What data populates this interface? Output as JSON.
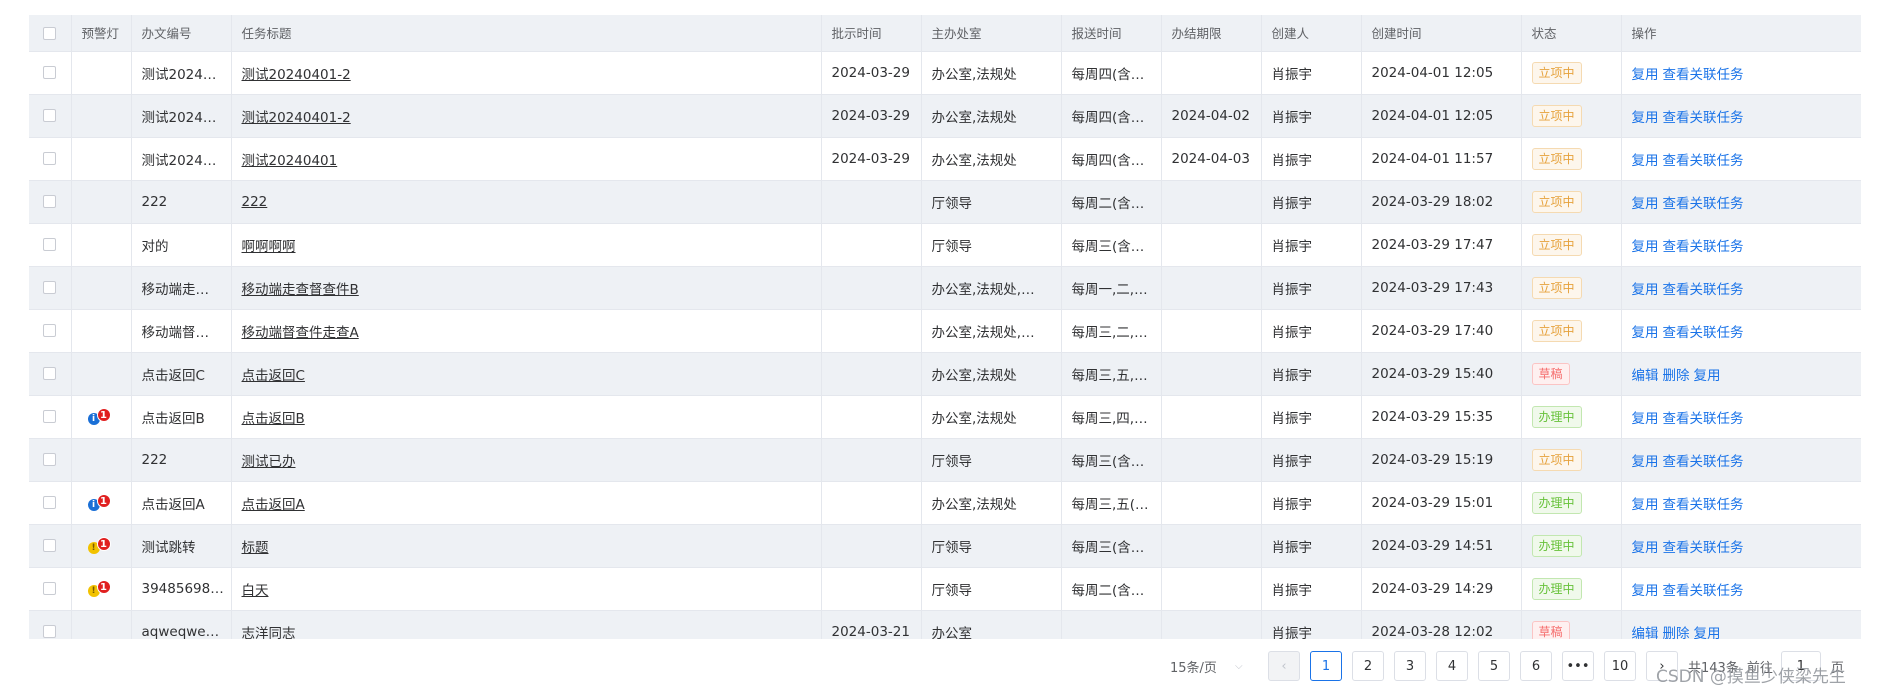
{
  "headers": [
    "",
    "预警灯",
    "办文编号",
    "任务标题",
    "批示时间",
    "主办处室",
    "报送时间",
    "办结期限",
    "创建人",
    "创建时间",
    "状态",
    "操作"
  ],
  "rows": [
    {
      "warning": "",
      "badge": "",
      "doc_no": "测试2024…",
      "title": "测试20240401-2",
      "instr_date": "2024-03-29",
      "dept": "办公室,法规处",
      "report": "每周四(含…",
      "deadline": "",
      "creator": "肖振宇",
      "created": "2024-04-01 12:05",
      "status": "立项中",
      "status_color": "orange",
      "ops": [
        "复用",
        "查看关联任务"
      ]
    },
    {
      "warning": "",
      "badge": "",
      "doc_no": "测试2024…",
      "title": "测试20240401-2",
      "instr_date": "2024-03-29",
      "dept": "办公室,法规处",
      "report": "每周四(含…",
      "deadline": "2024-04-02",
      "creator": "肖振宇",
      "created": "2024-04-01 12:05",
      "status": "立项中",
      "status_color": "orange",
      "ops": [
        "复用",
        "查看关联任务"
      ]
    },
    {
      "warning": "",
      "badge": "",
      "doc_no": "测试2024…",
      "title": "测试20240401",
      "instr_date": "2024-03-29",
      "dept": "办公室,法规处",
      "report": "每周四(含…",
      "deadline": "2024-04-03",
      "creator": "肖振宇",
      "created": "2024-04-01 11:57",
      "status": "立项中",
      "status_color": "orange",
      "ops": [
        "复用",
        "查看关联任务"
      ]
    },
    {
      "warning": "",
      "badge": "",
      "doc_no": "222",
      "title": "222",
      "instr_date": "",
      "dept": "厅领导",
      "report": "每周二(含…",
      "deadline": "",
      "creator": "肖振宇",
      "created": "2024-03-29 18:02",
      "status": "立项中",
      "status_color": "orange",
      "ops": [
        "复用",
        "查看关联任务"
      ]
    },
    {
      "warning": "",
      "badge": "",
      "doc_no": "对的",
      "title": "啊啊啊啊",
      "instr_date": "",
      "dept": "厅领导",
      "report": "每周三(含…",
      "deadline": "",
      "creator": "肖振宇",
      "created": "2024-03-29 17:47",
      "status": "立项中",
      "status_color": "orange",
      "ops": [
        "复用",
        "查看关联任务"
      ]
    },
    {
      "warning": "",
      "badge": "",
      "doc_no": "移动端走…",
      "title": "移动端走查督查件B",
      "instr_date": "",
      "dept": "办公室,法规处,…",
      "report": "每周一,二,…",
      "deadline": "",
      "creator": "肖振宇",
      "created": "2024-03-29 17:43",
      "status": "立项中",
      "status_color": "orange",
      "ops": [
        "复用",
        "查看关联任务"
      ]
    },
    {
      "warning": "",
      "badge": "",
      "doc_no": "移动端督…",
      "title": "移动端督查件走查A",
      "instr_date": "",
      "dept": "办公室,法规处,…",
      "report": "每周三,二,…",
      "deadline": "",
      "creator": "肖振宇",
      "created": "2024-03-29 17:40",
      "status": "立项中",
      "status_color": "orange",
      "ops": [
        "复用",
        "查看关联任务"
      ]
    },
    {
      "warning": "",
      "badge": "",
      "doc_no": "点击返回C",
      "title": "点击返回C",
      "instr_date": "",
      "dept": "办公室,法规处",
      "report": "每周三,五,…",
      "deadline": "",
      "creator": "肖振宇",
      "created": "2024-03-29 15:40",
      "status": "草稿",
      "status_color": "red",
      "ops": [
        "编辑",
        "删除",
        "复用"
      ]
    },
    {
      "warning": "blue",
      "badge": "1",
      "doc_no": "点击返回B",
      "title": "点击返回B",
      "instr_date": "",
      "dept": "办公室,法规处",
      "report": "每周三,四,…",
      "deadline": "",
      "creator": "肖振宇",
      "created": "2024-03-29 15:35",
      "status": "办理中",
      "status_color": "green",
      "ops": [
        "复用",
        "查看关联任务"
      ]
    },
    {
      "warning": "",
      "badge": "",
      "doc_no": "222",
      "title": "测试已办",
      "instr_date": "",
      "dept": "厅领导",
      "report": "每周三(含…",
      "deadline": "",
      "creator": "肖振宇",
      "created": "2024-03-29 15:19",
      "status": "立项中",
      "status_color": "orange",
      "ops": [
        "复用",
        "查看关联任务"
      ]
    },
    {
      "warning": "blue",
      "badge": "1",
      "doc_no": "点击返回A",
      "title": "点击返回A",
      "instr_date": "",
      "dept": "办公室,法规处",
      "report": "每周三,五(…",
      "deadline": "",
      "creator": "肖振宇",
      "created": "2024-03-29 15:01",
      "status": "办理中",
      "status_color": "green",
      "ops": [
        "复用",
        "查看关联任务"
      ]
    },
    {
      "warning": "yellow",
      "badge": "1",
      "doc_no": "测试跳转",
      "title": "标题",
      "instr_date": "",
      "dept": "厅领导",
      "report": "每周三(含…",
      "deadline": "",
      "creator": "肖振宇",
      "created": "2024-03-29 14:51",
      "status": "办理中",
      "status_color": "green",
      "ops": [
        "复用",
        "查看关联任务"
      ]
    },
    {
      "warning": "yellow",
      "badge": "1",
      "doc_no": "39485698…",
      "title": "白天",
      "instr_date": "",
      "dept": "厅领导",
      "report": "每周二(含…",
      "deadline": "",
      "creator": "肖振宇",
      "created": "2024-03-29 14:29",
      "status": "办理中",
      "status_color": "green",
      "ops": [
        "复用",
        "查看关联任务"
      ]
    },
    {
      "warning": "",
      "badge": "",
      "doc_no": "aqweqwe…",
      "title": "志洋同志",
      "instr_date": "2024-03-21",
      "dept": "办公室",
      "report": "",
      "deadline": "",
      "creator": "肖振宇",
      "created": "2024-03-28 12:02",
      "status": "草稿",
      "status_color": "red",
      "ops": [
        "编辑",
        "删除",
        "复用"
      ]
    }
  ],
  "pager": {
    "page_size": "15条/页",
    "prev": "‹",
    "pages": [
      "1",
      "2",
      "3",
      "4",
      "5",
      "6",
      "•••",
      "10"
    ],
    "next": "›",
    "total": "共143条",
    "goto": "前往",
    "goto_value": "1",
    "page_unit": "页"
  },
  "watermark": "CSDN @摸鱼少侠梁先生"
}
